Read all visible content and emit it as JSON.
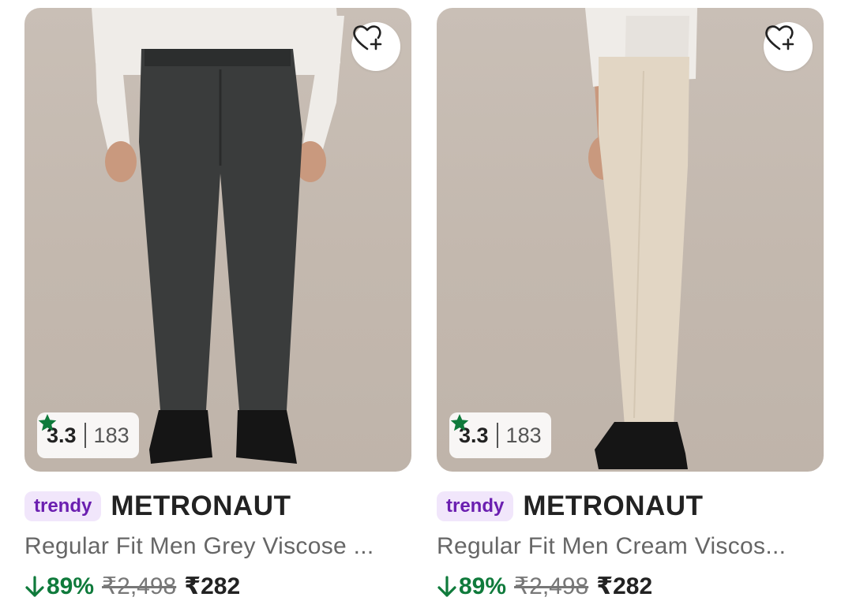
{
  "products": [
    {
      "rating": "3.3",
      "rating_count": "183",
      "badge": "trendy",
      "brand": "METRONAUT",
      "title": "Regular Fit Men Grey Viscose ...",
      "discount": "89%",
      "mrp": "₹2,498",
      "price": "₹282",
      "pant_color": "#3a3c3c",
      "icons": [
        "wishlist-add-icon",
        "star-icon",
        "arrow-down-icon"
      ]
    },
    {
      "rating": "3.3",
      "rating_count": "183",
      "badge": "trendy",
      "brand": "METRONAUT",
      "title": "Regular Fit Men Cream Viscos...",
      "discount": "89%",
      "mrp": "₹2,498",
      "price": "₹282",
      "pant_color": "#e2d6c4",
      "icons": [
        "wishlist-add-icon",
        "star-icon",
        "arrow-down-icon"
      ]
    }
  ],
  "colors": {
    "star": "#0f7a3b",
    "discount": "#0f7a3b",
    "badge_bg": "#f1e6fb",
    "badge_text": "#6b1fb0"
  }
}
